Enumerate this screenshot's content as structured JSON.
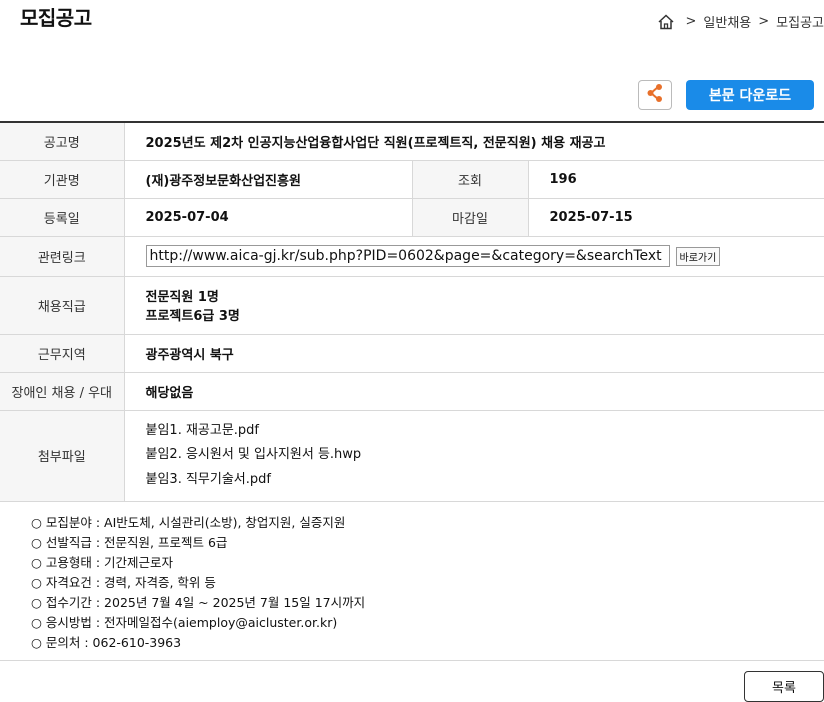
{
  "page": {
    "title": "모집공고"
  },
  "breadcrumb": {
    "items": [
      "일반채용",
      "모집공고"
    ],
    "separator": ">"
  },
  "actions": {
    "download_label": "본문 다운로드",
    "list_label": "목록",
    "go_label": "바로가기"
  },
  "colors": {
    "accent": "#1a8be8",
    "share_icon": "#e8702a",
    "header_bg": "#f6f6f6"
  },
  "table": {
    "title_label": "공고명",
    "title_value": "2025년도 제2차 인공지능산업융합사업단 직원(프로젝트직, 전문직원) 채용 재공고",
    "org_label": "기관명",
    "org_value": "(재)광주정보문화산업진흥원",
    "views_label": "조회",
    "views_value": "196",
    "reg_label": "등록일",
    "reg_value": "2025-07-04",
    "deadline_label": "마감일",
    "deadline_value": "2025-07-15",
    "link_label": "관련링크",
    "link_value": "http://www.aica-gj.kr/sub.php?PID=0602&page=&category=&searchText",
    "grade_label": "채용직급",
    "grades": [
      "전문직원 1명",
      "프로젝트6급 3명"
    ],
    "region_label": "근무지역",
    "region_value": "광주광역시 북구",
    "disabled_label": "장애인 채용 / 우대",
    "disabled_value": "해당없음",
    "attach_label": "첨부파일",
    "attachments": [
      "붙임1. 재공고문.pdf",
      "붙임2. 응시원서 및 입사지원서 등.hwp",
      "붙임3. 직무기술서.pdf"
    ]
  },
  "description": [
    "○ 모집분야 : AI반도체, 시설관리(소방), 창업지원, 실증지원",
    "○ 선발직급 : 전문직원, 프로젝트 6급",
    "○ 고용형태 : 기간제근로자",
    "○ 자격요건 : 경력, 자격증, 학위 등",
    "○ 접수기간 : 2025년 7월 4일 ~ 2025년 7월 15일 17시까지",
    "○ 응시방법 : 전자메일접수(aiemploy@aicluster.or.kr)",
    "○ 문의처 : 062-610-3963"
  ]
}
